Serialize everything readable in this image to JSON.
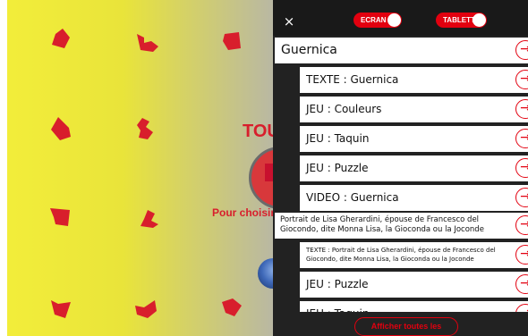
{
  "background": {
    "headline": "TOUC",
    "subline": "Pour choisir"
  },
  "topbar": {
    "close_glyph": "×",
    "toggle_screen_label": "ECRAN",
    "toggle_tablet_label": "TABLETTE"
  },
  "list": {
    "items": [
      {
        "label": "Guernica",
        "kind": "artwork"
      },
      {
        "label": "TEXTE : Guernica",
        "kind": "activity"
      },
      {
        "label": "JEU : Couleurs",
        "kind": "activity"
      },
      {
        "label": "JEU : Taquin",
        "kind": "activity"
      },
      {
        "label": "JEU : Puzzle",
        "kind": "activity"
      },
      {
        "label": "VIDEO : Guernica",
        "kind": "activity"
      },
      {
        "label": "Portrait de Lisa Gherardini, épouse de Francesco del Giocondo, dite Monna Lisa, la Gioconda ou la Joconde",
        "kind": "artwork"
      },
      {
        "label": "TEXTE : Portrait de Lisa Gherardini, épouse de Francesco del Giocondo, dite Monna Lisa, la Gioconda ou la Joconde",
        "kind": "activity"
      },
      {
        "label": "JEU : Puzzle",
        "kind": "activity"
      },
      {
        "label": "JEU : Taquin",
        "kind": "activity"
      }
    ]
  },
  "footer": {
    "show_all_label": "Afficher toutes les oeuvres"
  },
  "colors": {
    "accent": "#e2000f",
    "panel": "#222222",
    "background_yellow": "#f3ee3a"
  }
}
